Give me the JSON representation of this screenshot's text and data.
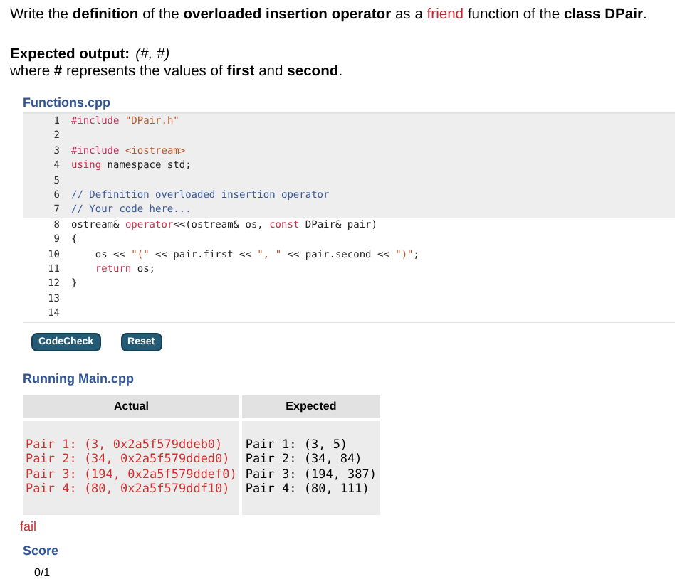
{
  "instruction": [
    {
      "kind": "plain",
      "text": "Write the **definition** of the **overloaded insertion operator** as a "
    },
    {
      "kind": "highlight",
      "text": "friend"
    },
    {
      "kind": "plain",
      "text": " function of the **class DPair**."
    }
  ],
  "expected_output": {
    "label": "Expected output:",
    "value": "(#, #)",
    "note": "where **#** represents the values of **first** and **second**."
  },
  "file": {
    "name": "Functions.cpp",
    "sections": [
      {
        "readonly": true,
        "lines": [
          {
            "number": "1",
            "tokens": [
              {
                "kind": "directive",
                "text": "#include "
              },
              {
                "kind": "string",
                "text": "\"DPair.h\""
              }
            ]
          },
          {
            "number": "2"
          },
          {
            "number": "3",
            "tokens": [
              {
                "kind": "directive",
                "text": "#include "
              },
              {
                "kind": "string",
                "text": "<iostream>"
              }
            ]
          },
          {
            "number": "4",
            "tokens": [
              {
                "kind": "keyword",
                "text": "using"
              },
              {
                "kind": "plain",
                "text": " namespace std;"
              }
            ]
          },
          {
            "number": "5"
          },
          {
            "number": "6",
            "tokens": [
              {
                "kind": "comment",
                "text": "// Definition overloaded insertion operator"
              }
            ]
          },
          {
            "number": "7",
            "tokens": [
              {
                "kind": "comment",
                "text": "// Your code here..."
              }
            ]
          }
        ]
      },
      {
        "readonly": false,
        "lines": [
          {
            "number": "8",
            "tokens": [
              {
                "kind": "plain",
                "text": "ostream& "
              },
              {
                "kind": "keyword",
                "text": "operator"
              },
              {
                "kind": "plain",
                "text": "<<(ostream& os, "
              },
              {
                "kind": "keyword",
                "text": "const"
              },
              {
                "kind": "plain",
                "text": " DPair& pair)"
              }
            ]
          },
          {
            "number": "9",
            "tokens": [
              {
                "kind": "plain",
                "text": "{"
              }
            ]
          },
          {
            "number": "10",
            "tokens": [
              {
                "kind": "plain",
                "text": "    os << "
              },
              {
                "kind": "string",
                "text": "\"(\""
              },
              {
                "kind": "plain",
                "text": " << pair.first << "
              },
              {
                "kind": "string",
                "text": "\", \""
              },
              {
                "kind": "plain",
                "text": " << pair.second << "
              },
              {
                "kind": "string",
                "text": "\")\""
              },
              {
                "kind": "plain",
                "text": ";"
              }
            ]
          },
          {
            "number": "11",
            "tokens": [
              {
                "kind": "keyword",
                "text": "    return"
              },
              {
                "kind": "plain",
                "text": " os;"
              }
            ]
          },
          {
            "number": "12",
            "tokens": [
              {
                "kind": "plain",
                "text": "}"
              }
            ]
          },
          {
            "number": "13"
          },
          {
            "number": "14"
          }
        ]
      }
    ]
  },
  "buttons": [
    "CodeCheck",
    "Reset"
  ],
  "run": {
    "title": "Running Main.cpp",
    "columns": [
      "Actual",
      "Expected"
    ],
    "actual": [
      "Pair 1: (3, 0x2a5f579ddeb0)",
      "Pair 2: (34, 0x2a5f579dded0)",
      "Pair 3: (194, 0x2a5f579ddef0)",
      "Pair 4: (80, 0x2a5f579ddf10)"
    ],
    "expected": [
      "Pair 1: (3, 5)",
      "Pair 2: (34, 84)",
      "Pair 3: (194, 387)",
      "Pair 4: (80, 111)"
    ],
    "actual_matches": false,
    "result": "fail"
  },
  "score": {
    "title": "Score",
    "value": "0/1"
  }
}
